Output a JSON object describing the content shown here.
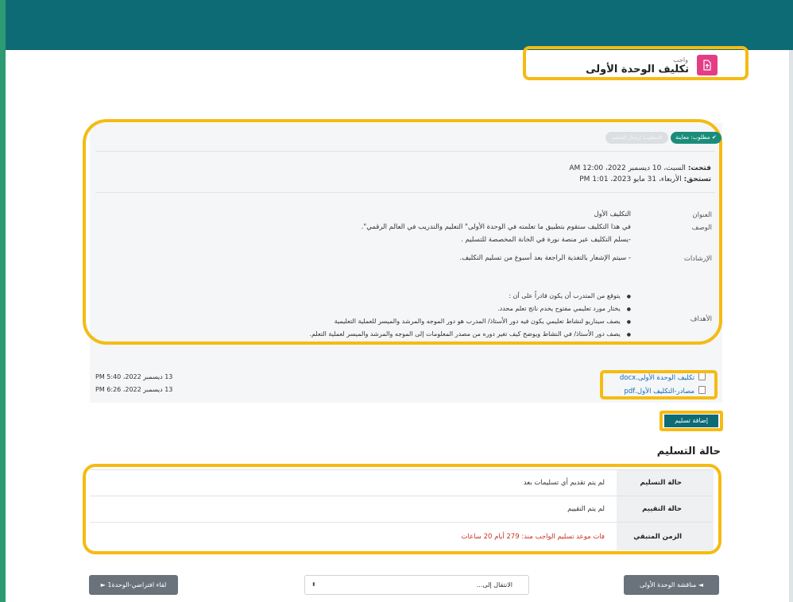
{
  "header": {
    "kind": "واجب",
    "title": "تكليف الوحدة الأولى",
    "icon": "assignment-upload-icon",
    "icon_color": "#e43d85"
  },
  "badges": {
    "completion": "✔ مطلوب: معاينة",
    "pending": "المطلوب: إرسال التسليم"
  },
  "dates": {
    "opened_label": "فتحت:",
    "opened_value": "السبت، 10 ديسمبر 2022، 12:00 AM",
    "due_label": "تستحق:",
    "due_value": "الأربعاء، 31 مايو 2023، 1:01 PM"
  },
  "details": {
    "title_label": "العنوان",
    "title_value": "التكليف الأول",
    "desc_label": "الوصف",
    "desc_line1": "في هذا التكليف ستقوم بتطبيق ما تعلمته في الوحدة الأولى\" التعليم والتدريب في العالم الرقمي\".",
    "desc_line2": "-يسلم التكليف عبر منصة نورة  في الخانة المخصصة للتسليم .",
    "guide_label": "الإرشادات",
    "guide_value": "- سيتم الإشعار بالتغذية الراجعة بعد أسبوع من تسليم التكليف.",
    "objectives_label": "الأهداف",
    "objectives": [
      "يتوقع من المتدرب أن يكون قادراً على أن :",
      "يختار مورد تعليمي مفتوح يخدم ناتج تعلم محدد.",
      "يصف سيناريو لنشاط تعليمي يكون فيه دور الأستاذ/ المدرب هو دور الموجه والمرشد والميسر للعملية التعليمية",
      "يصف دور الأستاذ/ في النشاط ويوضح كيف تغير دوره من مصدر المعلومات إلى الموجه والمرشد والميسر لعملية التعلم."
    ]
  },
  "files": [
    {
      "name": "تكليف الوحدة الأولى.docx",
      "date": "13 ديسمبر 2022، 5:40 PM"
    },
    {
      "name": "مصادر-التكليف الأول.pdf",
      "date": "13 ديسمبر 2022، 6:26 PM"
    }
  ],
  "add_submission": "إضافة تسليم",
  "status": {
    "heading": "حالة التسليم",
    "rows": [
      {
        "label": "حالة التسليم",
        "value": "لم يتم تقديم أي تسليمات بعد"
      },
      {
        "label": "حالة التقييم",
        "value": "لم يتم التقييم"
      },
      {
        "label": "الزمن المتبقي",
        "value": "فات موعد تسليم الواجب منذ: 279 أيام 20 ساعات"
      }
    ]
  },
  "nav": {
    "prev": "◄ مناقشة  الوحدة الأولى",
    "jump_placeholder": "الانتقال إلى...",
    "next": "لقاء افتراضي-الوحدة1 ►"
  },
  "colors": {
    "topbar": "#0d6b75",
    "accent": "#2c9a72",
    "highlight": "#f5bb13",
    "overdue": "#ca3120",
    "link": "#0f6cbf"
  }
}
